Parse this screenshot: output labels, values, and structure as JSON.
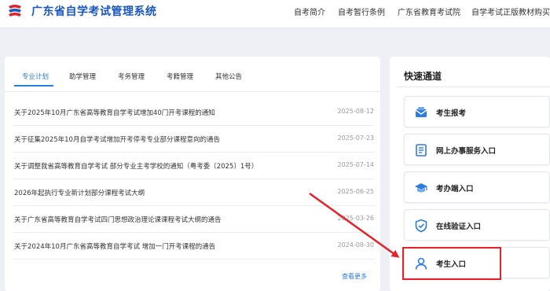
{
  "header": {
    "site_title": "广东省自学考试管理系统",
    "nav": [
      "自考简介",
      "自考暂行条例",
      "广东省教育考试院",
      "自学考试正版教材购买"
    ]
  },
  "tabs": [
    "专业计划",
    "助学管理",
    "考务管理",
    "考籍管理",
    "其他公告"
  ],
  "active_tab": "专业计划",
  "news": [
    {
      "title": "关于2025年10月广东省高等教育自学考试增加40门开考课程的通知",
      "date": "2025-08-12"
    },
    {
      "title": "关于征集2025年10月自学考试增加开考停考专业部分课程意向的通告",
      "date": "2025-07-23"
    },
    {
      "title": "关于调整我省高等教育自学考试 部分专业主考学校的通知（粤考委〔2025〕1号）",
      "date": "2025-07-14"
    },
    {
      "title": "2026年起执行专业新计划部分课程考试大纲",
      "date": "2025-06-25"
    },
    {
      "title": "关于广东省高等教育自学考试四门思想政治理论课课程考试大纲的通告",
      "date": "2025-03-26"
    },
    {
      "title": "关于2024年10月广东省高等教育自学考试 增加一门开考课程的通告",
      "date": "2024-08-30"
    }
  ],
  "more_label": "查看更多",
  "quick_access": {
    "title": "快速通道",
    "items": [
      {
        "label": "考生报考",
        "icon": "envelope-icon"
      },
      {
        "label": "网上办事服务入口",
        "icon": "document-icon"
      },
      {
        "label": "考办端入口",
        "icon": "graduation-cap-icon"
      },
      {
        "label": "在线验证入口",
        "icon": "shield-check-icon"
      },
      {
        "label": "考生入口",
        "icon": "user-icon"
      }
    ]
  },
  "colors": {
    "brand": "#1a56c4",
    "accent": "#2a7de1",
    "highlight": "#e8202a"
  }
}
